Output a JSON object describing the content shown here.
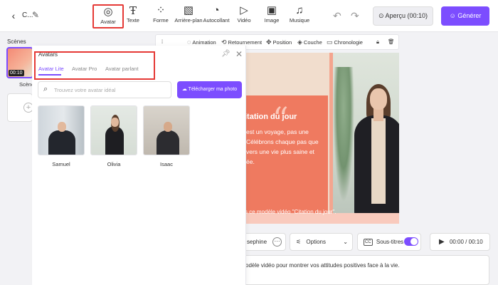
{
  "header": {
    "project_name": "C...",
    "tools": [
      {
        "label": "Avatar",
        "icon": "avatar-icon"
      },
      {
        "label": "Texte",
        "icon": "text-icon"
      },
      {
        "label": "Forme",
        "icon": "shapes-icon"
      },
      {
        "label": "Arrière-plan",
        "icon": "background-icon"
      },
      {
        "label": "Autocollant",
        "icon": "sticker-icon"
      },
      {
        "label": "Vidéo",
        "icon": "video-icon"
      },
      {
        "label": "Image",
        "icon": "image-icon"
      },
      {
        "label": "Musique",
        "icon": "music-icon"
      }
    ],
    "preview_label": "Aperçu (00:10)",
    "generate_label": "Générer"
  },
  "scenes": {
    "title": "Scènes",
    "items": [
      {
        "time": "00:10",
        "name": "Scène"
      }
    ]
  },
  "canvas_toolbar": {
    "items": [
      "Animation",
      "Retournement",
      "Position",
      "Couche",
      "Chronologie"
    ]
  },
  "canvas": {
    "quote_mark": "“",
    "quote_title": "itation du jour",
    "quote_lines": [
      "est un voyage, pas une",
      "Célébrons chaque pas que",
      "vers une vie plus saine et",
      "ée."
    ],
    "caption": "s ce modèle vidéo \"Citation du jour\"."
  },
  "bottom": {
    "voice": "sephine",
    "options_label": "Options",
    "subtitles_label": "Sous-titres",
    "subtitles_on": true,
    "time": "00:00 / 00:10",
    "script": "odèle vidéo pour montrer vos attitudes positives face à la vie."
  },
  "avatar_panel": {
    "title": "Avatars",
    "tabs": [
      "Avatar Lite",
      "Avatar Pro",
      "Avatar parlant"
    ],
    "active_tab": 0,
    "search_placeholder": "Trouvez votre avatar idéal",
    "upload_label": "Télécharger ma photo",
    "avatars": [
      {
        "name": "Samuel"
      },
      {
        "name": "Olivia"
      },
      {
        "name": "Isaac"
      }
    ]
  },
  "colors": {
    "accent": "#7c4dff",
    "highlight": "#e53935",
    "quote_card": "#ef7a60"
  }
}
